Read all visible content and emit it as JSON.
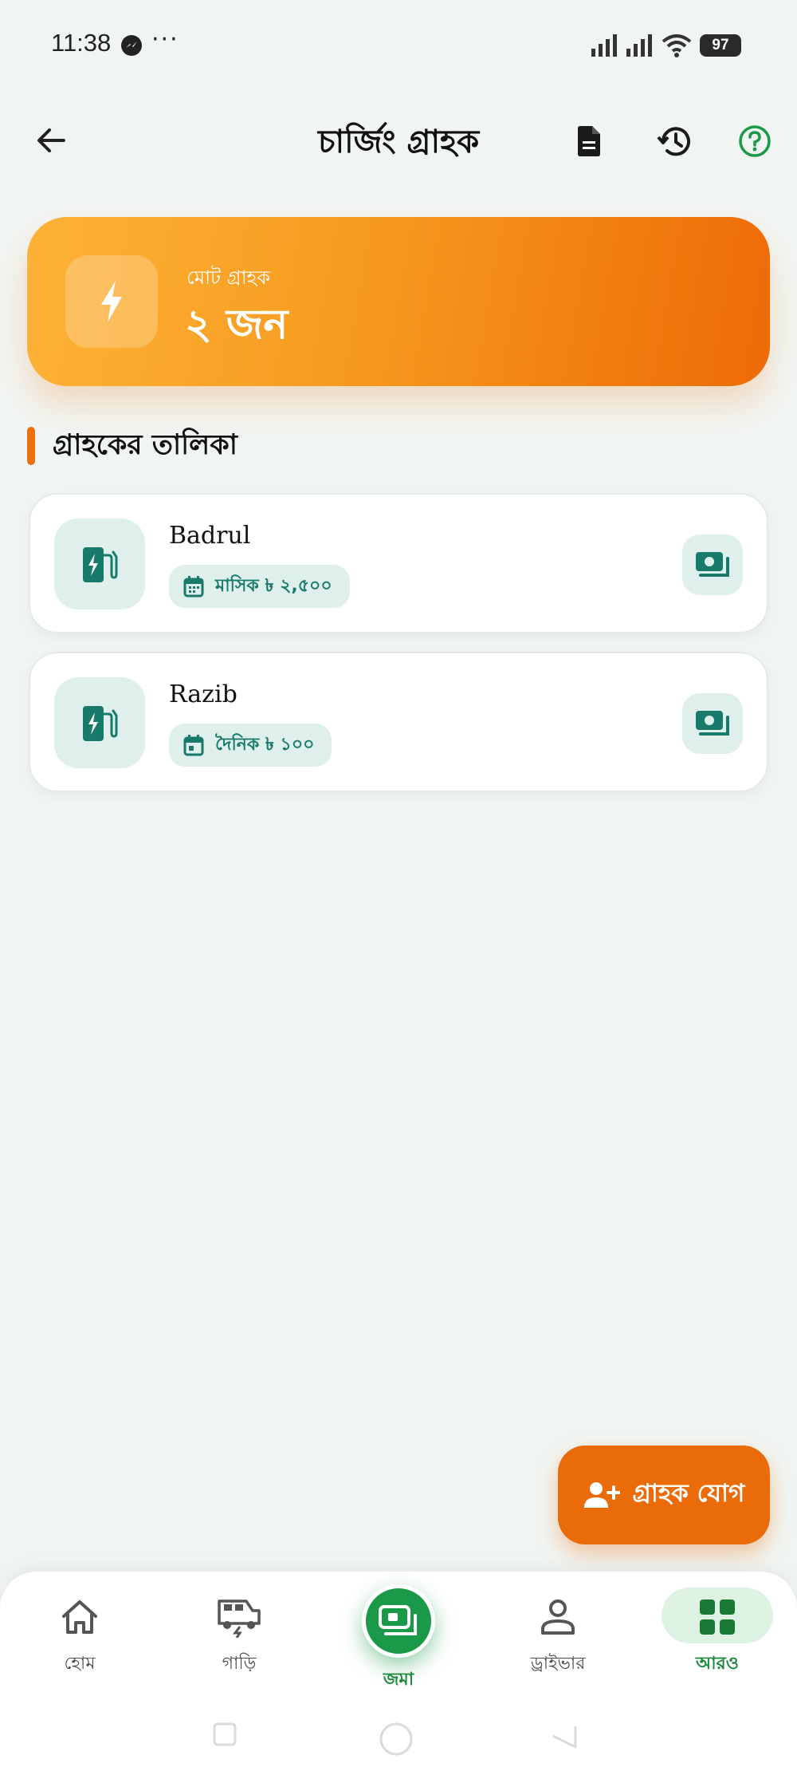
{
  "status": {
    "time": "11:38",
    "dots": "···",
    "battery": "97"
  },
  "appbar": {
    "title": "চার্জিং গ্রাহক"
  },
  "summary": {
    "label": "মোট গ্রাহক",
    "count": "২ জন"
  },
  "section": {
    "title": "গ্রাহকের তালিকা"
  },
  "customers": [
    {
      "name": "Badrul",
      "plan": "মাসিক ৳ ২,৫০০"
    },
    {
      "name": "Razib",
      "plan": "দৈনিক ৳ ১০০"
    }
  ],
  "fab": {
    "label": "গ্রাহক যোগ"
  },
  "nav": {
    "home": "হোম",
    "vehicle": "গাড়ি",
    "deposit": "জমা",
    "driver": "ড্রাইভার",
    "more": "আরও"
  },
  "colors": {
    "accent_orange": "#ea6b0a",
    "accent_green": "#1a9a48",
    "teal": "#177a6a"
  }
}
